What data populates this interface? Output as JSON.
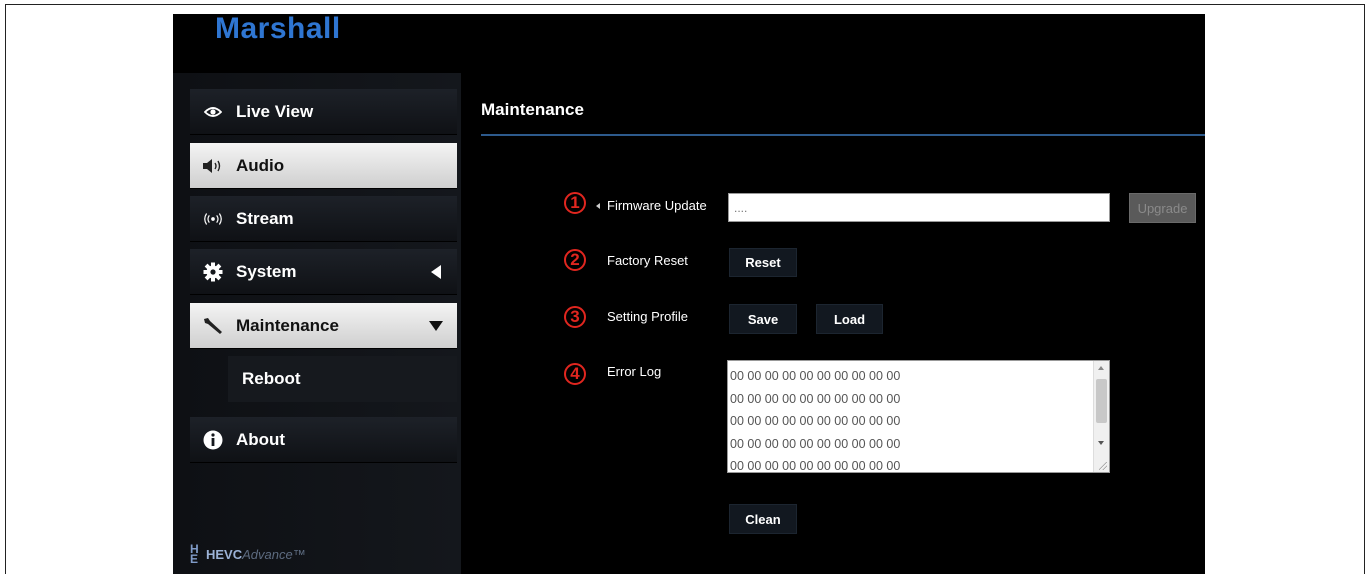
{
  "app": {
    "logo": "Marshall"
  },
  "sidebar": {
    "items": [
      {
        "label": "Live View",
        "icon": "eye-icon"
      },
      {
        "label": "Audio",
        "icon": "speaker-icon"
      },
      {
        "label": "Stream",
        "icon": "broadcast-icon"
      },
      {
        "label": "System",
        "icon": "gear-icon",
        "caret": "collapsed"
      },
      {
        "label": "Maintenance",
        "icon": "wrench-icon",
        "caret": "expanded"
      },
      {
        "label": "Reboot"
      },
      {
        "label": "About",
        "icon": "info-icon"
      }
    ],
    "footer": {
      "brand_mark": "HE",
      "brand": "HEVC",
      "brand_suffix": "Advance™"
    }
  },
  "main": {
    "title": "Maintenance",
    "rows": [
      {
        "number": "1",
        "label": "Firmware Update",
        "input_value": "....",
        "button": "Upgrade"
      },
      {
        "number": "2",
        "label": "Factory Reset",
        "button": "Reset"
      },
      {
        "number": "3",
        "label": "Setting Profile",
        "buttons": [
          "Save",
          "Load"
        ]
      },
      {
        "number": "4",
        "label": "Error Log",
        "log_lines": [
          "00 00 00 00 00 00 00 00 00 00",
          "00 00 00 00 00 00 00 00 00 00",
          "00 00 00 00 00 00 00 00 00 00",
          "00 00 00 00 00 00 00 00 00 00",
          "00 00 00 00 00 00 00 00 00 00"
        ],
        "button": "Clean"
      }
    ]
  },
  "colors": {
    "accent": "#2f76d2",
    "callout": "#e0261f",
    "rule": "#2d5a8c"
  }
}
